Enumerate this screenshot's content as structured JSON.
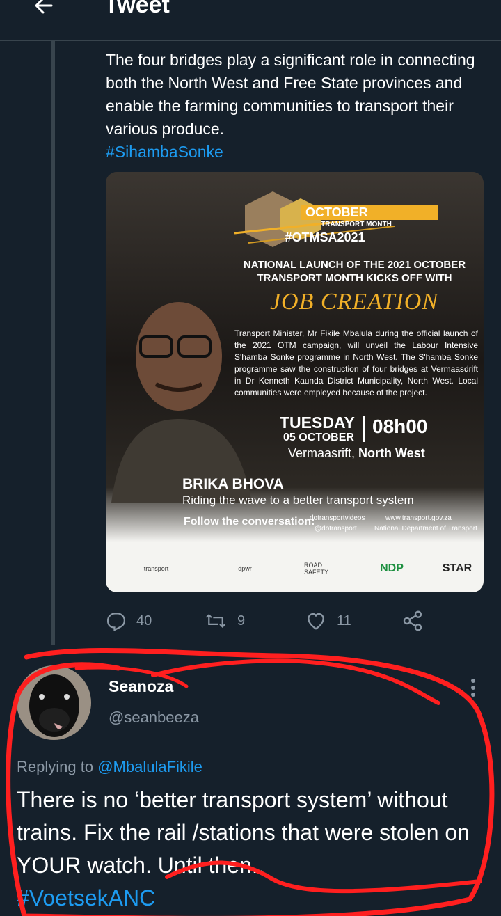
{
  "header": {
    "title": "Tweet"
  },
  "tweet": {
    "text": "The four bridges play a significant role in connecting both the North West and Free State provinces and enable the farming communities to transport their various produce.",
    "hashtag": "#SihambaSonke",
    "image": {
      "campaign_month": "OCTOBER",
      "campaign_subtitle": "TRANSPORT MONTH",
      "campaign_tag": "#OTMSA2021",
      "headline_1": "NATIONAL LAUNCH OF THE 2021 OCTOBER",
      "headline_2": "TRANSPORT MONTH KICKS OFF WITH",
      "headline_3": "JOB CREATION",
      "description": "Transport Minister, Mr Fikile Mbalula during the official launch of the 2021 OTM campaign, will unveil the Labour Intensive S'hamba Sonke programme in North West. The S'hamba Sonke programme saw the construction of four bridges at Vermaasdrift in Dr Kenneth Kaunda District Municipality, North West. Local communities were employed because of the project.",
      "day": "TUESDAY",
      "date": "05 OCTOBER",
      "time": "08h00",
      "place_prefix": "Vermaasrift, ",
      "place_strong": "North West",
      "slogan_title": "BRIKA BHOVA",
      "slogan": "Riding the wave to a better transport system",
      "follow": "Follow the conversation:",
      "channel_video": "dotransportvideos",
      "channel_web": "www.transport.gov.za",
      "channel_social": "@dotransport",
      "channel_dept": "National Department of Transport",
      "logo_transport": "transport",
      "logo_dpwr": "dpwr",
      "logo_road": "ROAD SAFETY",
      "logo_ndp": "NDP",
      "logo_star": "STAR"
    },
    "stats": {
      "replies": "40",
      "retweets": "9",
      "likes": "11"
    }
  },
  "reply": {
    "name": "Seanoza",
    "handle": "@seanbeeza",
    "replying_prefix": "Replying to ",
    "replying_to": "@MbalulaFikile",
    "text": "There is no ‘better transport system’ without trains. Fix the rail /stations that were stolen on YOUR watch. Until then..",
    "hashtag": "#VoetsekANC"
  },
  "colors": {
    "background": "#15202b",
    "accent": "#1d9bf0",
    "muted": "#8b98a5",
    "scribble": "#ff1f1f"
  },
  "icons": {
    "back": "back-arrow-icon",
    "reply": "reply-icon",
    "retweet": "retweet-icon",
    "like": "heart-icon",
    "share": "share-icon",
    "more": "more-options-icon"
  }
}
